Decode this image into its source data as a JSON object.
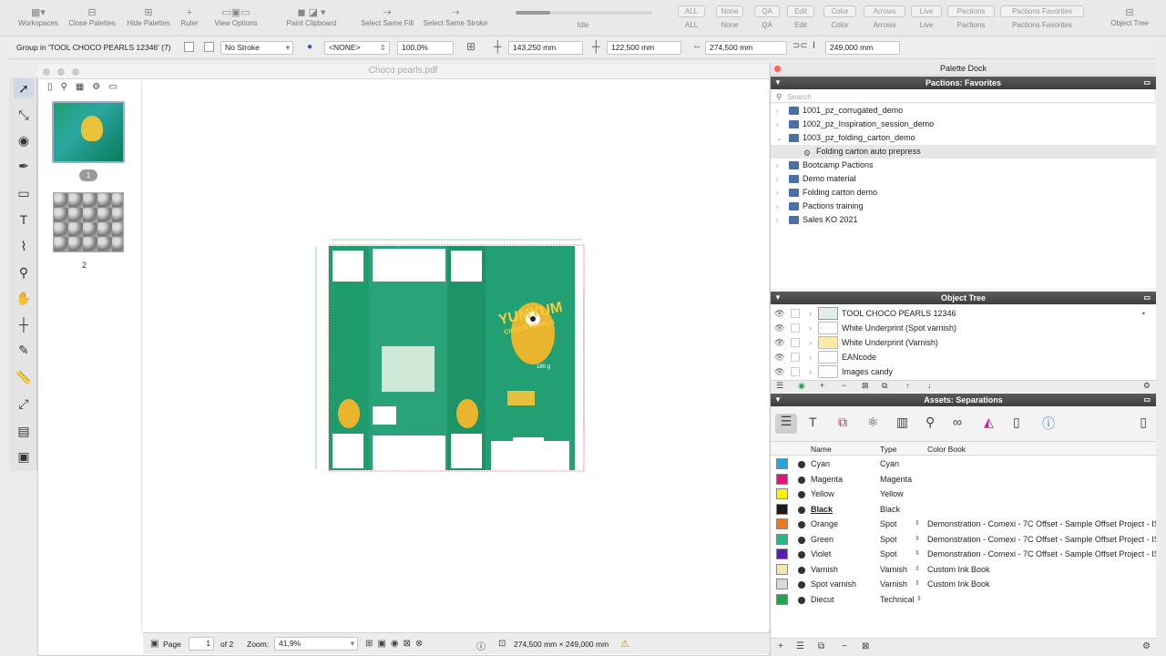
{
  "toolbar": {
    "groups": [
      {
        "label": "Workspaces",
        "icon": "workspaces-icon"
      },
      {
        "label": "Close Palettes",
        "icon": "close-palettes-icon"
      },
      {
        "label": "Hide Palettes",
        "icon": "hide-palettes-icon"
      },
      {
        "label": "Ruler",
        "icon": "ruler-icon"
      },
      {
        "label": "View Options",
        "icon": "view-options-icon"
      },
      {
        "label": "Paint Clipboard",
        "icon": "paint-clipboard-icon"
      },
      {
        "label": "Select Same Fill",
        "icon": "select-fill-icon"
      },
      {
        "label": "Select Same Stroke",
        "icon": "select-stroke-icon"
      }
    ],
    "status": "Idle",
    "filters": [
      {
        "top": "ALL",
        "bottom": "ALL"
      },
      {
        "top": "None",
        "bottom": "None"
      },
      {
        "top": "QA",
        "bottom": "QA"
      },
      {
        "top": "Edit",
        "bottom": "Edit"
      },
      {
        "top": "Color",
        "bottom": "Color"
      },
      {
        "top": "Arrows",
        "bottom": "Arrows"
      },
      {
        "top": "Live",
        "bottom": "Live"
      },
      {
        "top": "Pactions",
        "bottom": "Pactions"
      },
      {
        "top": "Pactions Favorites",
        "bottom": "Pactions Favorites"
      }
    ],
    "object_tree_label": "Object Tree"
  },
  "options": {
    "selection": "Group in 'TOOL CHOCO PEARLS 12346' (7)",
    "stroke": "No Stroke",
    "fill": "<NONE>",
    "opacity": "100,0%",
    "x": "143,250 mm",
    "y": "122,500 mm",
    "width": "274,500 mm",
    "height": "249,000 mm"
  },
  "document": {
    "title": "Choco pearls.pdf",
    "pages": [
      {
        "label": "1"
      },
      {
        "label": "2"
      }
    ],
    "artwork": {
      "brand": "YUMYUM",
      "product": "CHOCO PEARLS",
      "weight": "180 g"
    }
  },
  "status": {
    "page_label": "Page",
    "page_value": "1",
    "of_label": "of 2",
    "zoom_label": "Zoom:",
    "zoom_value": "41,9%",
    "dimensions": "274,500 mm × 249,000 mm"
  },
  "dock": {
    "title": "Palette Dock",
    "pactions": {
      "title": "Pactions: Favorites",
      "search_placeholder": "Search",
      "items": [
        {
          "label": "1001_pz_corrugated_demo",
          "expanded": false
        },
        {
          "label": "1002_pz_Inspiration_session_demo",
          "expanded": false
        },
        {
          "label": "1003_pz_folding_carton_demo",
          "expanded": true
        },
        {
          "label": "Folding carton auto prepress",
          "child": true
        },
        {
          "label": "Bootcamp Pactions",
          "expanded": false
        },
        {
          "label": "Demo material",
          "expanded": false
        },
        {
          "label": "Folding carton demo",
          "expanded": false
        },
        {
          "label": "Pactions training",
          "expanded": false
        },
        {
          "label": "Sales KO 2021",
          "expanded": false
        }
      ]
    },
    "object_tree": {
      "title": "Object Tree",
      "items": [
        {
          "label": "TOOL CHOCO PEARLS 12346"
        },
        {
          "label": "White Underprint (Spot varnish)"
        },
        {
          "label": "White Underprint (Varnish)"
        },
        {
          "label": "EANcode"
        },
        {
          "label": "Images candy"
        }
      ]
    },
    "separations": {
      "title": "Assets: Separations",
      "columns": [
        "Name",
        "Type",
        "Color Book"
      ],
      "rows": [
        {
          "name": "Cyan",
          "type": "Cyan",
          "book": "",
          "color": "#1ea7e1"
        },
        {
          "name": "Magenta",
          "type": "Magenta",
          "book": "",
          "color": "#e4127b"
        },
        {
          "name": "Yellow",
          "type": "Yellow",
          "book": "",
          "color": "#fff200"
        },
        {
          "name": "Black",
          "type": "Black",
          "book": "",
          "color": "#1a1a1a"
        },
        {
          "name": "Orange",
          "type": "Spot",
          "book": "Demonstration - Comexi - 7C Offset - Sample Offset Project - IS",
          "color": "#f07a1a"
        },
        {
          "name": "Green",
          "type": "Spot",
          "book": "Demonstration - Comexi - 7C Offset - Sample Offset Project - IS",
          "color": "#1fb98a"
        },
        {
          "name": "Violet",
          "type": "Spot",
          "book": "Demonstration - Comexi - 7C Offset - Sample Offset Project - IS",
          "color": "#5a1fb0"
        },
        {
          "name": "Varnish",
          "type": "Varnish",
          "book": "Custom Ink Book",
          "color": "#f7e7a8"
        },
        {
          "name": "Spot varnish",
          "type": "Varnish",
          "book": "Custom Ink Book",
          "color": "#d9d9d9"
        },
        {
          "name": "Diecut",
          "type": "Technical",
          "book": "",
          "color": "#1aa84a"
        }
      ]
    }
  }
}
